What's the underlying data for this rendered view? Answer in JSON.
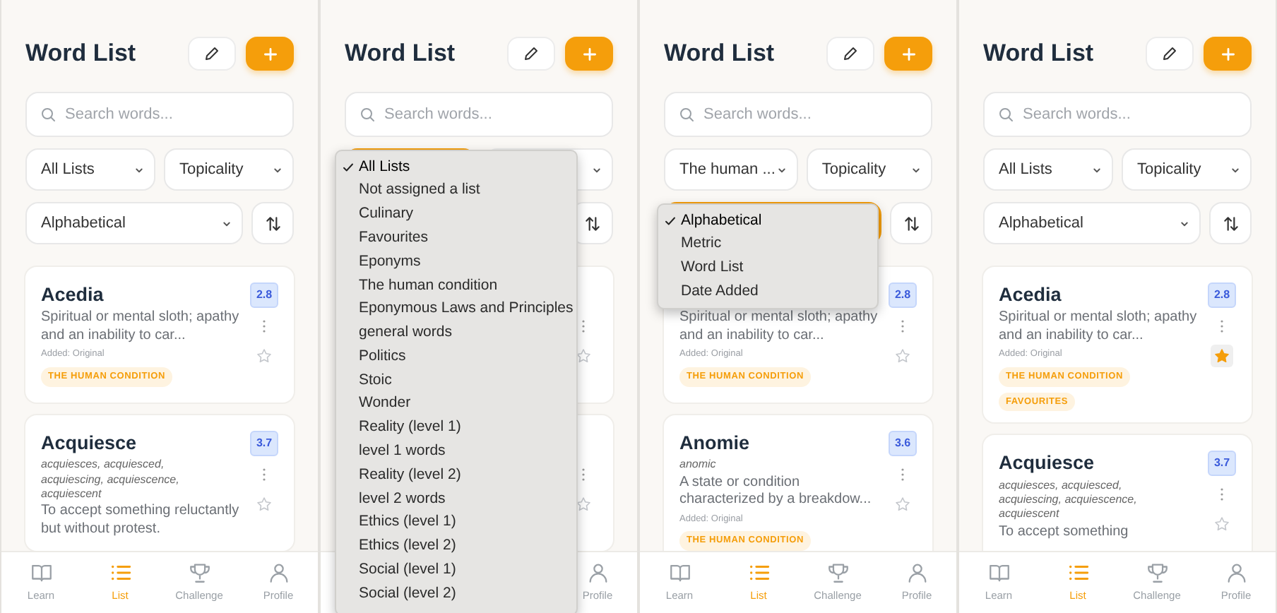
{
  "screens": [
    {
      "title": "Word List",
      "search_placeholder": "Search words...",
      "list_filter": {
        "value": "All Lists",
        "focused": false
      },
      "topic_filter": {
        "value": "Topicality"
      },
      "sort": {
        "value": "Alphabetical",
        "focused": false
      },
      "cards": [
        {
          "word": "Acedia",
          "definition": "Spiritual or mental sloth; apathy and an inability to car...",
          "added": "Added: Original",
          "tags": [
            "THE HUMAN CONDITION"
          ],
          "score": "2.8",
          "starred": false
        },
        {
          "word": "Acquiesce",
          "forms": "acquiesces, acquiesced, acquiescing, acquiescence, acquiescent",
          "definition": "To accept something reluctantly but without protest.",
          "score": "3.7",
          "starred": false
        }
      ],
      "nav": [
        {
          "kind": "learn",
          "label": "Learn",
          "selected": false
        },
        {
          "kind": "list",
          "label": "List",
          "selected": true
        },
        {
          "kind": "challenge",
          "label": "Challenge",
          "selected": false
        },
        {
          "kind": "profile",
          "label": "Profile",
          "selected": false
        }
      ]
    },
    {
      "title": "Word List",
      "search_placeholder": "Search words...",
      "list_filter": {
        "focused": true
      },
      "cards": [
        {
          "starred": false
        },
        {
          "starred": false
        }
      ],
      "nav": [
        {
          "kind": "profile",
          "label": "Profile",
          "selected": false
        }
      ],
      "menu": {
        "options": [
          {
            "label": "All Lists",
            "selected": true
          },
          {
            "label": "Not assigned a list",
            "selected": false
          },
          {
            "label": "Culinary",
            "selected": false
          },
          {
            "label": "Favourites",
            "selected": false
          },
          {
            "label": "Eponyms",
            "selected": false
          },
          {
            "label": "The human condition",
            "selected": false
          },
          {
            "label": "Eponymous Laws and Principles",
            "selected": false
          },
          {
            "label": "general words",
            "selected": false
          },
          {
            "label": "Politics",
            "selected": false
          },
          {
            "label": "Stoic",
            "selected": false
          },
          {
            "label": "Wonder",
            "selected": false
          },
          {
            "label": "Reality (level 1)",
            "selected": false
          },
          {
            "label": "level 1 words",
            "selected": false
          },
          {
            "label": "Reality (level 2)",
            "selected": false
          },
          {
            "label": "level 2 words",
            "selected": false
          },
          {
            "label": "Ethics (level 1)",
            "selected": false
          },
          {
            "label": "Ethics (level 2)",
            "selected": false
          },
          {
            "label": "Social (level 1)",
            "selected": false
          },
          {
            "label": "Social (level 2)",
            "selected": false
          }
        ]
      }
    },
    {
      "title": "Word List",
      "search_placeholder": "Search words...",
      "list_filter": {
        "value": "The human ...",
        "focused": false
      },
      "topic_filter": {
        "value": "Topicality"
      },
      "sort": {
        "focused": true
      },
      "cards": [
        {
          "definition": "Spiritual or mental sloth; apathy and an inability to car...",
          "added": "Added: Original",
          "tags": [
            "THE HUMAN CONDITION"
          ],
          "score": "2.8",
          "starred": false
        },
        {
          "word": "Anomie",
          "forms": "anomic",
          "definition": "A state or condition characterized by a breakdow...",
          "added": "Added: Original",
          "tags": [
            "THE HUMAN CONDITION"
          ],
          "score": "3.6",
          "starred": false
        }
      ],
      "nav": [
        {
          "kind": "learn",
          "label": "Learn",
          "selected": false
        },
        {
          "kind": "list",
          "label": "List",
          "selected": true
        },
        {
          "kind": "challenge",
          "label": "Challenge",
          "selected": false
        },
        {
          "kind": "profile",
          "label": "Profile",
          "selected": false
        }
      ],
      "menu": {
        "options": [
          {
            "label": "Alphabetical",
            "selected": true
          },
          {
            "label": "Metric",
            "selected": false
          },
          {
            "label": "Word List",
            "selected": false
          },
          {
            "label": "Date Added",
            "selected": false
          }
        ]
      }
    },
    {
      "title": "Word List",
      "search_placeholder": "Search words...",
      "list_filter": {
        "value": "All Lists",
        "focused": false
      },
      "topic_filter": {
        "value": "Topicality"
      },
      "sort": {
        "value": "Alphabetical",
        "focused": false
      },
      "cards": [
        {
          "word": "Acedia",
          "definition": "Spiritual or mental sloth; apathy and an inability to car...",
          "added": "Added: Original",
          "tags": [
            "THE HUMAN CONDITION",
            "FAVOURITES"
          ],
          "score": "2.8",
          "starred": true
        },
        {
          "word": "Acquiesce",
          "forms": "acquiesces, acquiesced, acquiescing, acquiescence, acquiescent",
          "definition": "To accept something",
          "score": "3.7",
          "starred": false
        }
      ],
      "nav": [
        {
          "kind": "learn",
          "label": "Learn",
          "selected": false
        },
        {
          "kind": "list",
          "label": "List",
          "selected": true
        },
        {
          "kind": "challenge",
          "label": "Challenge",
          "selected": false
        },
        {
          "kind": "profile",
          "label": "Profile",
          "selected": false
        }
      ]
    }
  ]
}
